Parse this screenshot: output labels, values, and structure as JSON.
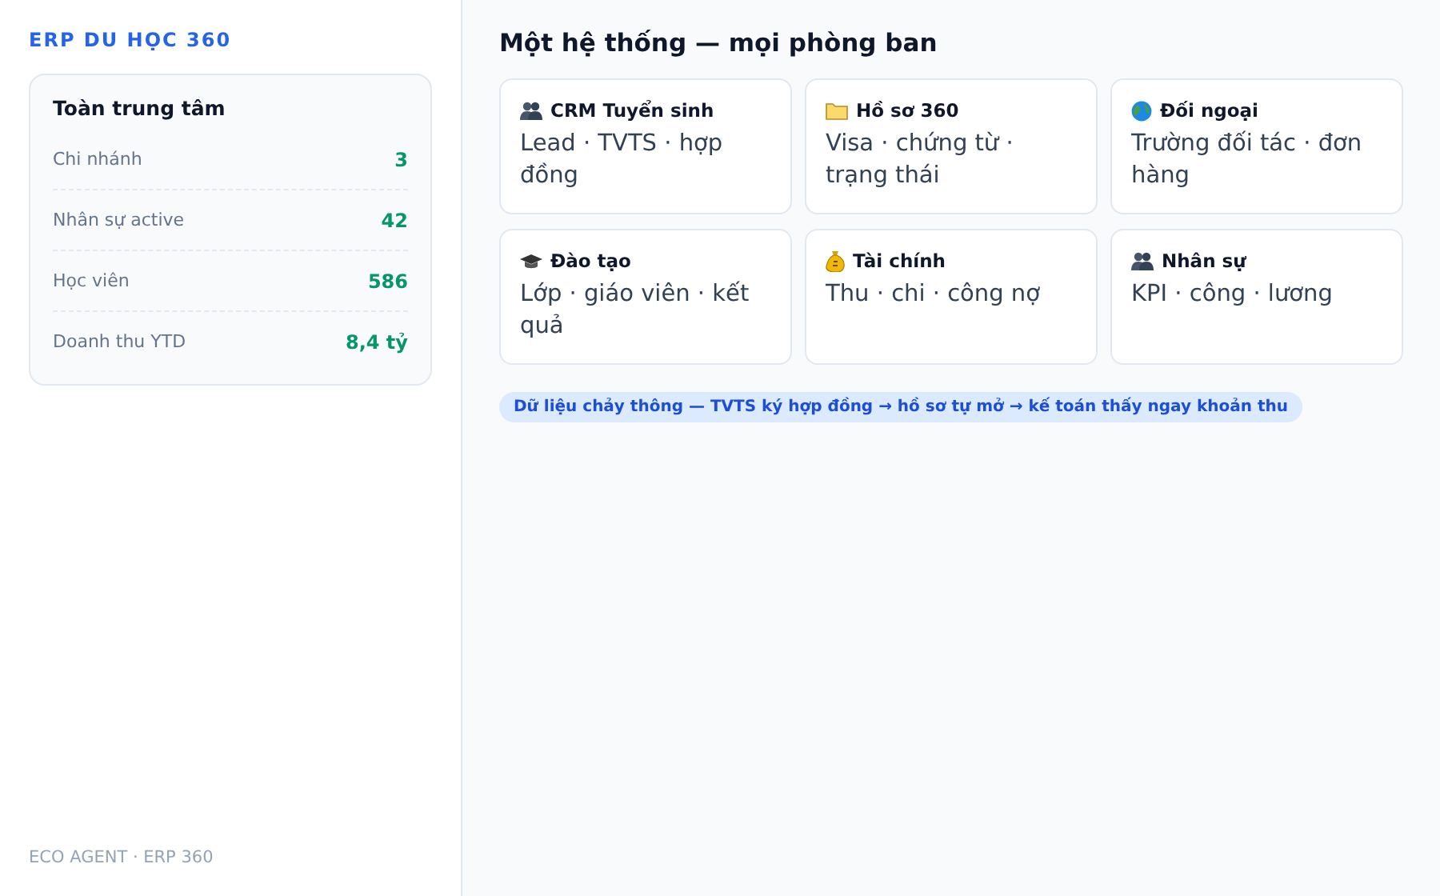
{
  "brand": "ERP DU HỌC 360",
  "summary": {
    "title": "Toàn trung tâm",
    "rows": [
      {
        "label": "Chi nhánh",
        "value": "3"
      },
      {
        "label": "Nhân sự active",
        "value": "42"
      },
      {
        "label": "Học viên",
        "value": "586"
      },
      {
        "label": "Doanh thu YTD",
        "value": "8,4 tỷ"
      }
    ]
  },
  "footer": "ECO AGENT · ERP 360",
  "heading": "Một hệ thống — mọi phòng ban",
  "modules": [
    {
      "kind": "people",
      "title": "CRM Tuyển sinh",
      "desc": "Lead · TVTS · hợp đồng"
    },
    {
      "kind": "folder",
      "title": "Hồ sơ 360",
      "desc": "Visa · chứng từ · trạng thái"
    },
    {
      "kind": "globe",
      "title": "Đối ngoại",
      "desc": "Trường đối tác · đơn hàng"
    },
    {
      "kind": "cap",
      "title": "Đào tạo",
      "desc": "Lớp · giáo viên · kết quả"
    },
    {
      "kind": "money",
      "title": "Tài chính",
      "desc": "Thu · chi · công nợ"
    },
    {
      "kind": "people",
      "title": "Nhân sự",
      "desc": "KPI · công · lương"
    }
  ],
  "flow_note": "Dữ liệu chảy thông — TVTS ký hợp đồng → hồ sơ tự mở → kế toán thấy ngay khoản thu"
}
